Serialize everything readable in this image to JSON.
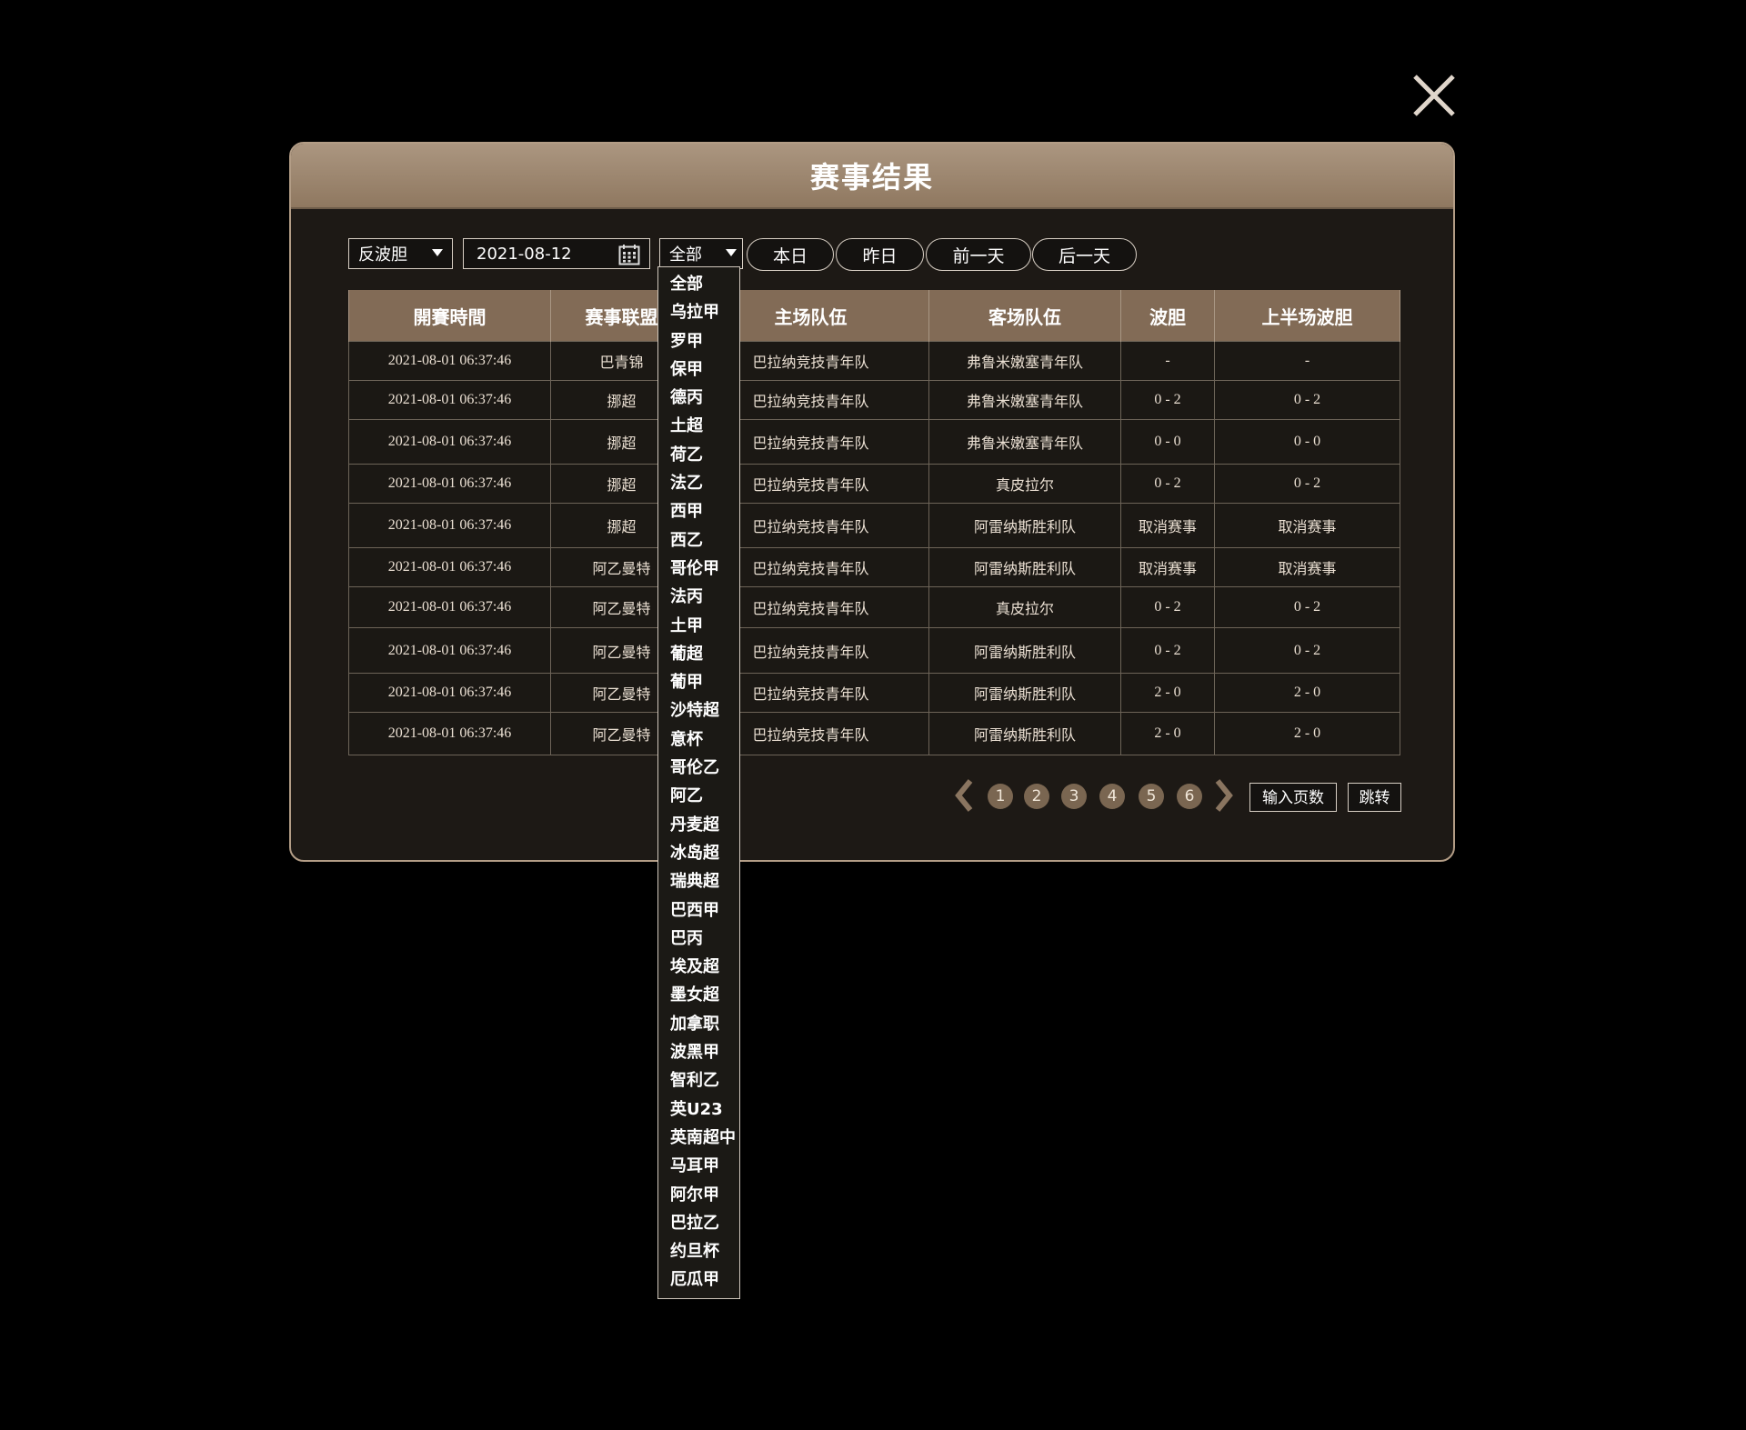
{
  "modal": {
    "title": "赛事结果"
  },
  "filters": {
    "bet_type": "反波胆",
    "date": "2021-08-12",
    "league": "全部",
    "buttons": [
      "本日",
      "昨日",
      "前一天",
      "后一天"
    ]
  },
  "table": {
    "headers": [
      "開賽時間",
      "赛事联盟",
      "主场队伍",
      "客场队伍",
      "波胆",
      "上半场波胆"
    ],
    "rows": [
      [
        "2021-08-01 06:37:46",
        "巴青锦",
        "巴拉纳竞技青年队",
        "弗鲁米嫩塞青年队",
        "-",
        "-"
      ],
      [
        "2021-08-01 06:37:46",
        "挪超",
        "巴拉纳竞技青年队",
        "弗鲁米嫩塞青年队",
        "0 - 2",
        "0 - 2"
      ],
      [
        "2021-08-01 06:37:46",
        "挪超",
        "巴拉纳竞技青年队",
        "弗鲁米嫩塞青年队",
        "0 - 0",
        "0 - 0"
      ],
      [
        "2021-08-01 06:37:46",
        "挪超",
        "巴拉纳竞技青年队",
        "真皮拉尔",
        "0 - 2",
        "0 - 2"
      ],
      [
        "2021-08-01 06:37:46",
        "挪超",
        "巴拉纳竞技青年队",
        "阿雷纳斯胜利队",
        "取消赛事",
        "取消赛事"
      ],
      [
        "2021-08-01 06:37:46",
        "阿乙曼特",
        "巴拉纳竞技青年队",
        "阿雷纳斯胜利队",
        "取消赛事",
        "取消赛事"
      ],
      [
        "2021-08-01 06:37:46",
        "阿乙曼特",
        "巴拉纳竞技青年队",
        "真皮拉尔",
        "0 - 2",
        "0 - 2"
      ],
      [
        "2021-08-01 06:37:46",
        "阿乙曼特",
        "巴拉纳竞技青年队",
        "阿雷纳斯胜利队",
        "0 - 2",
        "0 - 2"
      ],
      [
        "2021-08-01 06:37:46",
        "阿乙曼特",
        "巴拉纳竞技青年队",
        "阿雷纳斯胜利队",
        "2 - 0",
        "2 - 0"
      ],
      [
        "2021-08-01 06:37:46",
        "阿乙曼特",
        "巴拉纳竞技青年队",
        "阿雷纳斯胜利队",
        "2 - 0",
        "2 - 0"
      ]
    ]
  },
  "dropdown": {
    "options": [
      "全部",
      "乌拉甲",
      "罗甲",
      "保甲",
      "德丙",
      "土超",
      "荷乙",
      "法乙",
      "西甲",
      "西乙",
      "哥伦甲",
      "法丙",
      "土甲",
      "葡超",
      "葡甲",
      "沙特超",
      "意杯",
      "哥伦乙",
      "阿乙",
      "丹麦超",
      "冰岛超",
      "瑞典超",
      "巴西甲",
      "巴丙",
      "埃及超",
      "墨女超",
      "加拿职",
      "波黑甲",
      "智利乙",
      "英U23",
      "英南超中",
      "马耳甲",
      "阿尔甲",
      "巴拉乙",
      "约旦杯",
      "厄瓜甲"
    ]
  },
  "pagination": {
    "pages": [
      "1",
      "2",
      "3",
      "4",
      "5",
      "6"
    ],
    "input_label": "输入页数",
    "jump_label": "跳转"
  },
  "colors": {
    "header_bg": "#8f7860",
    "accent": "#826b56",
    "background": "#000000"
  },
  "icons": {
    "close": "close-icon",
    "calendar": "calendar-icon",
    "prev": "chevron-left-icon",
    "next": "chevron-right-icon",
    "dropdown": "caret-down-icon"
  }
}
